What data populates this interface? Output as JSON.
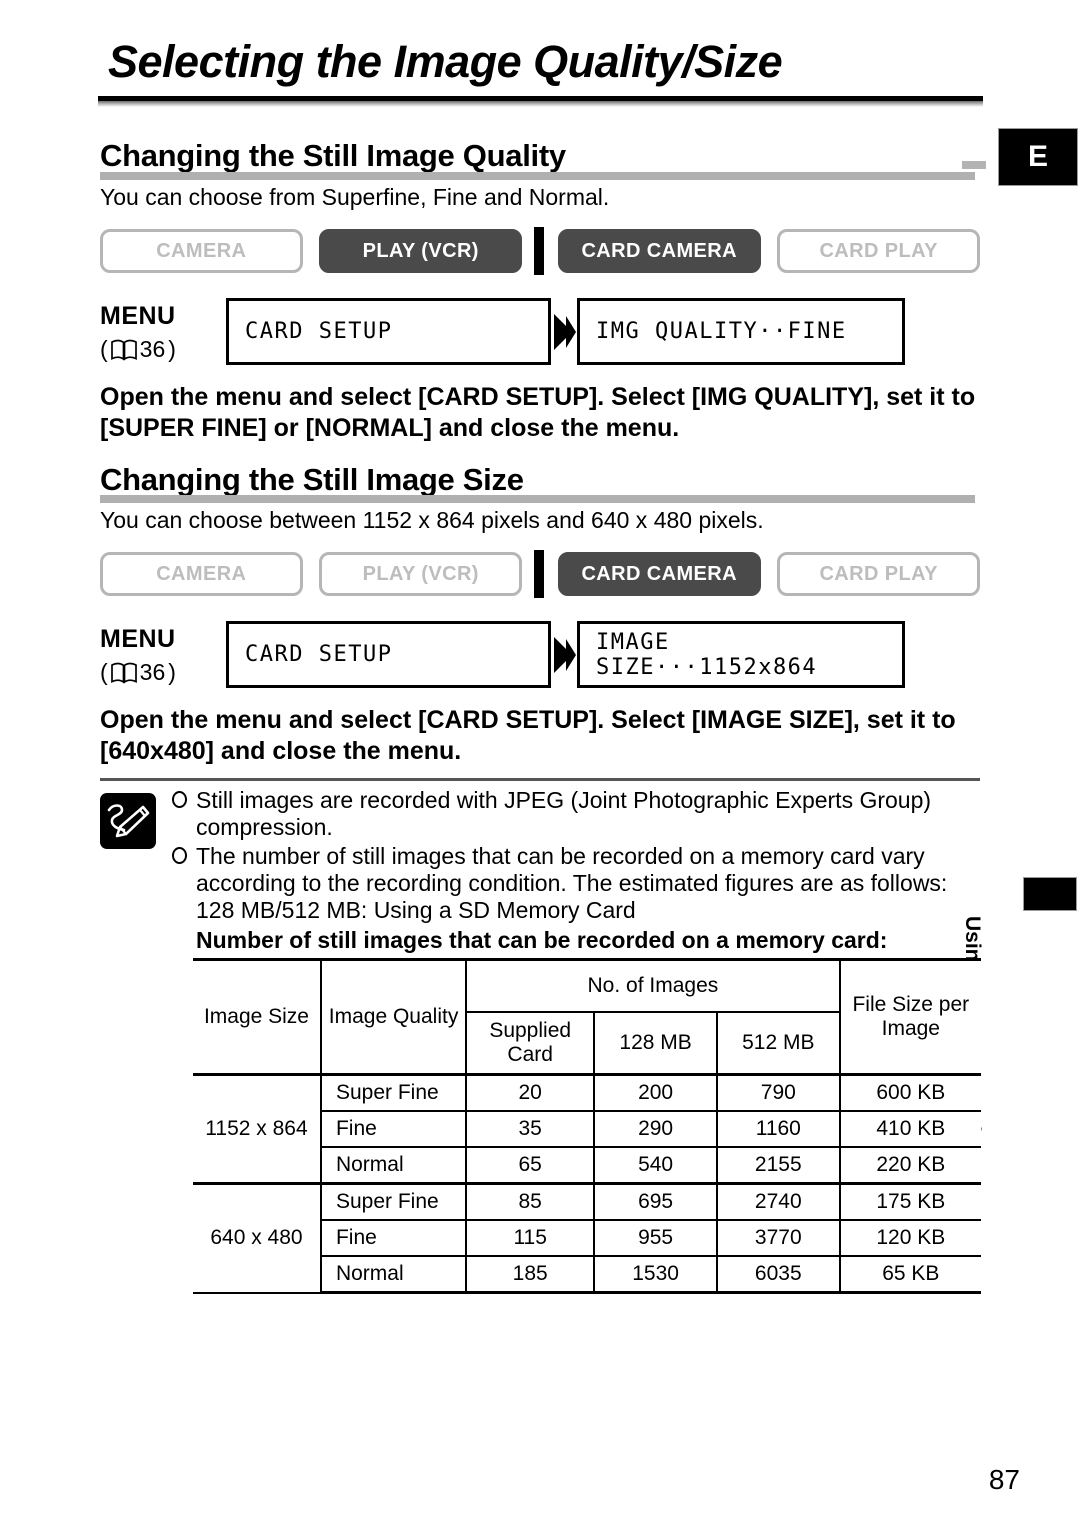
{
  "page": {
    "title": "Selecting the Image Quality/Size",
    "number": "87",
    "lang_tab": "E",
    "side_tab_text": "Using a Memory Card"
  },
  "section_quality": {
    "heading": "Changing the Still Image Quality",
    "intro": "You can choose from Superfine, Fine and Normal.",
    "modes": [
      {
        "label": "CAMERA",
        "active": false
      },
      {
        "label": "PLAY (VCR)",
        "active": true
      },
      {
        "label": "CARD CAMERA",
        "active": true
      },
      {
        "label": "CARD PLAY",
        "active": false
      }
    ],
    "menu": {
      "label": "MENU",
      "ref_open": "(",
      "ref_page": "36",
      "ref_close": ")",
      "box1": "CARD SETUP",
      "box2": "IMG QUALITY··FINE",
      "arrow": "right-arrow-icon"
    },
    "instruction": "Open the menu and select [CARD SETUP]. Select [IMG QUALITY], set it to [SUPER FINE] or [NORMAL] and close the menu."
  },
  "section_size": {
    "heading": "Changing the Still Image Size",
    "intro": "You can choose between 1152 x 864 pixels and 640 x 480 pixels.",
    "modes": [
      {
        "label": "CAMERA",
        "active": false
      },
      {
        "label": "PLAY (VCR)",
        "active": false
      },
      {
        "label": "CARD CAMERA",
        "active": true
      },
      {
        "label": "CARD PLAY",
        "active": false
      }
    ],
    "menu": {
      "label": "MENU",
      "ref_open": "(",
      "ref_page": "36",
      "ref_close": ")",
      "box1": "CARD SETUP",
      "box2": "IMAGE SIZE···1152x864",
      "arrow": "right-arrow-icon"
    },
    "instruction": "Open the menu and select [CARD SETUP]. Select [IMAGE SIZE], set it to [640x480] and close the menu."
  },
  "notes": {
    "items": [
      "Still images are recorded with JPEG (Joint Photographic Experts Group) compression.",
      "The number of still images that can be recorded on a memory card vary according to the recording condition. The estimated figures are as follows:"
    ],
    "sub_line": "128 MB/512 MB: Using a SD Memory Card",
    "bold_line": "Number of still images that can be recorded on a memory card:"
  },
  "table": {
    "headers": {
      "image_size": "Image Size",
      "image_quality": "Image Quality",
      "no_of_images": "No. of Images",
      "supplied_card": "Supplied\nCard",
      "supplied_card_l1": "Supplied",
      "supplied_card_l2": "Card",
      "mb128": "128 MB",
      "mb512": "512 MB",
      "file_size_l1": "File Size per",
      "file_size_l2": "Image"
    },
    "groups": [
      {
        "size": "1152 x 864",
        "rows": [
          {
            "quality": "Super Fine",
            "supplied": "20",
            "mb128": "200",
            "mb512": "790",
            "filesize": "600 KB"
          },
          {
            "quality": "Fine",
            "supplied": "35",
            "mb128": "290",
            "mb512": "1160",
            "filesize": "410 KB"
          },
          {
            "quality": "Normal",
            "supplied": "65",
            "mb128": "540",
            "mb512": "2155",
            "filesize": "220 KB"
          }
        ]
      },
      {
        "size": "640 x 480",
        "rows": [
          {
            "quality": "Super Fine",
            "supplied": "85",
            "mb128": "695",
            "mb512": "2740",
            "filesize": "175 KB"
          },
          {
            "quality": "Fine",
            "supplied": "115",
            "mb128": "955",
            "mb512": "3770",
            "filesize": "120 KB"
          },
          {
            "quality": "Normal",
            "supplied": "185",
            "mb128": "1530",
            "mb512": "6035",
            "filesize": "65 KB"
          }
        ]
      }
    ]
  },
  "colors": {
    "active_button": "#4a4a4a",
    "inactive_border": "#b6b6b6",
    "inactive_text": "#bdbdbd",
    "rule_gray": "#b0b0b0"
  }
}
